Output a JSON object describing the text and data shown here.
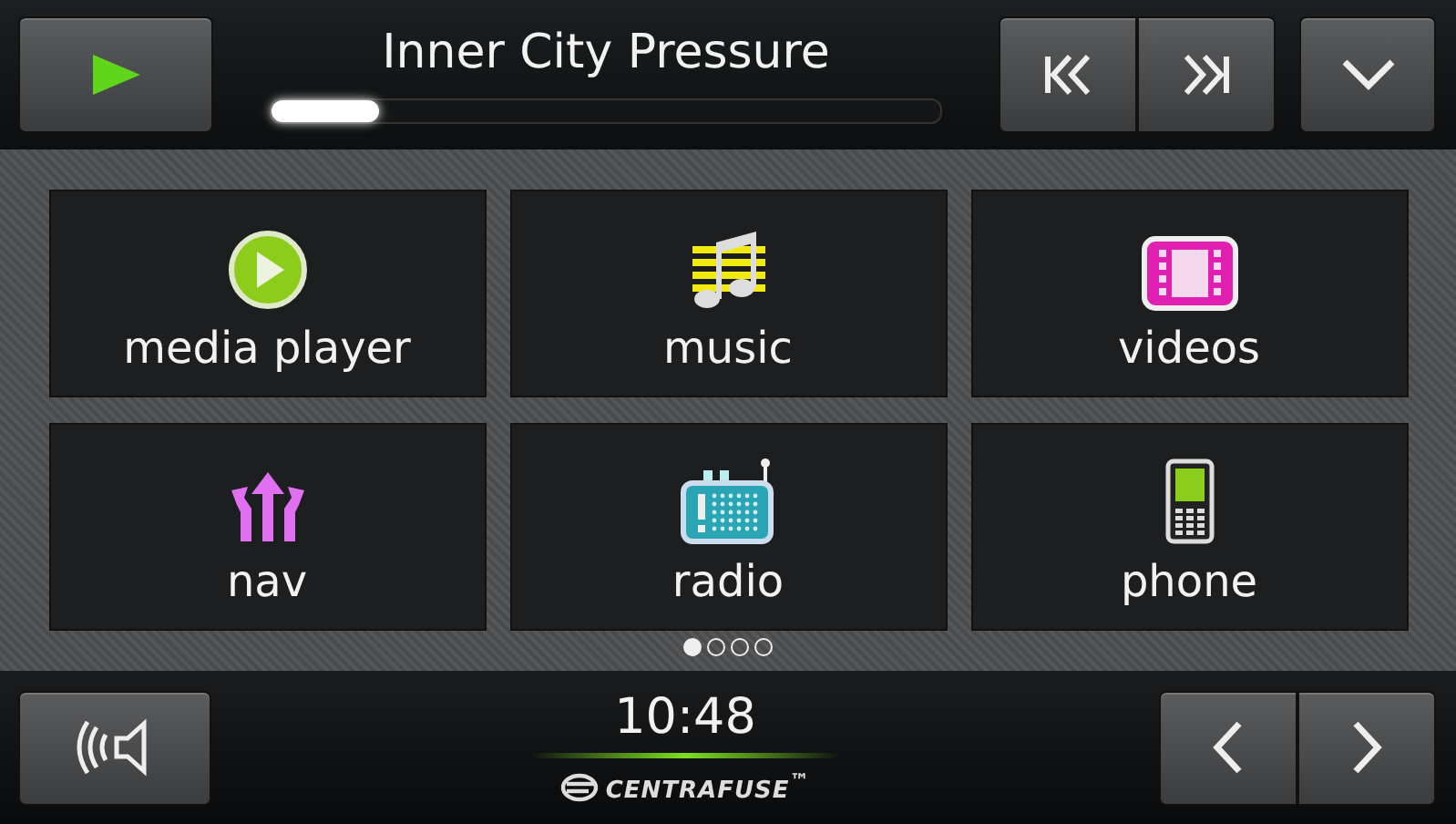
{
  "now_playing": {
    "title": "Inner City Pressure",
    "level": 0.16
  },
  "tiles": [
    {
      "label": "media player",
      "kind": "media"
    },
    {
      "label": "music",
      "kind": "music"
    },
    {
      "label": "videos",
      "kind": "videos"
    },
    {
      "label": "nav",
      "kind": "nav"
    },
    {
      "label": "radio",
      "kind": "radio"
    },
    {
      "label": "phone",
      "kind": "phone"
    }
  ],
  "pages": [
    {
      "selected": true
    },
    {
      "selected": false
    },
    {
      "selected": false
    },
    {
      "selected": false
    }
  ],
  "clock": "10:48",
  "logo": "CENTRAFUSE$^{™}$"
}
